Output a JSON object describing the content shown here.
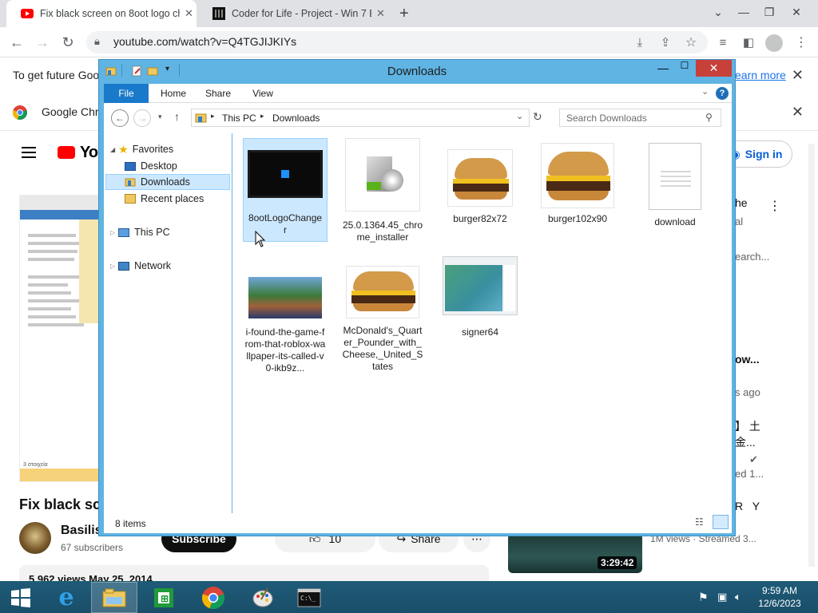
{
  "browser": {
    "tabs": [
      {
        "title": "Fix black screen on 8oot logo cha",
        "active": true
      },
      {
        "title": "Coder for Life - Project - Win 7 B",
        "active": false
      }
    ],
    "url": "youtube.com/watch?v=Q4TGJIJKIYs",
    "info_bar_text": "To get future Goog",
    "info_bar_link": "earn more",
    "chrome_bar_text": "Google Chro"
  },
  "youtube": {
    "logo_text": "Yo",
    "sign_in": "Sign in",
    "video_title": "Fix black sc",
    "channel_name": "Basilis",
    "subscribers": "67 subscribers",
    "subscribe_label": "Subscribe",
    "like_count": "10",
    "share_label": "Share",
    "views_line": "5,962 views  May 25, 2014",
    "thumb_caption": "3 στοιχεία",
    "sidebar": {
      "line1": "he",
      "line2": "al",
      "line3": "earch...",
      "line4": "ow...",
      "line5": "s ago",
      "line6": "】 土",
      "line7": "金...",
      "line8": "ed 1...",
      "line9": "R Y",
      "rec_meta": "1M views · Streamed 3...",
      "rec_duration": "3:29:42"
    }
  },
  "explorer": {
    "title": "Downloads",
    "ribbon_tabs": [
      "File",
      "Home",
      "Share",
      "View"
    ],
    "breadcrumb": [
      "This PC",
      "Downloads"
    ],
    "search_placeholder": "Search Downloads",
    "nav": {
      "favorites": "Favorites",
      "desktop": "Desktop",
      "downloads": "Downloads",
      "recent": "Recent places",
      "thispc": "This PC",
      "network": "Network"
    },
    "files": [
      {
        "name": "8ootLogoChanger",
        "kind": "tablet"
      },
      {
        "name": "25.0.1364.45_chrome_installer",
        "kind": "installer"
      },
      {
        "name": "burger82x72",
        "kind": "burger"
      },
      {
        "name": "burger102x90",
        "kind": "burger"
      },
      {
        "name": "download",
        "kind": "document"
      },
      {
        "name": "i-found-the-game-from-that-roblox-wallpaper-its-called-v0-ikb9z...",
        "kind": "image"
      },
      {
        "name": "McDonald's_Quarter_Pounder_with_Cheese,_United_States",
        "kind": "burger"
      },
      {
        "name": "signer64",
        "kind": "window"
      }
    ],
    "status": "8 items"
  },
  "taskbar": {
    "time": "9:59 AM",
    "date": "12/6/2023"
  }
}
